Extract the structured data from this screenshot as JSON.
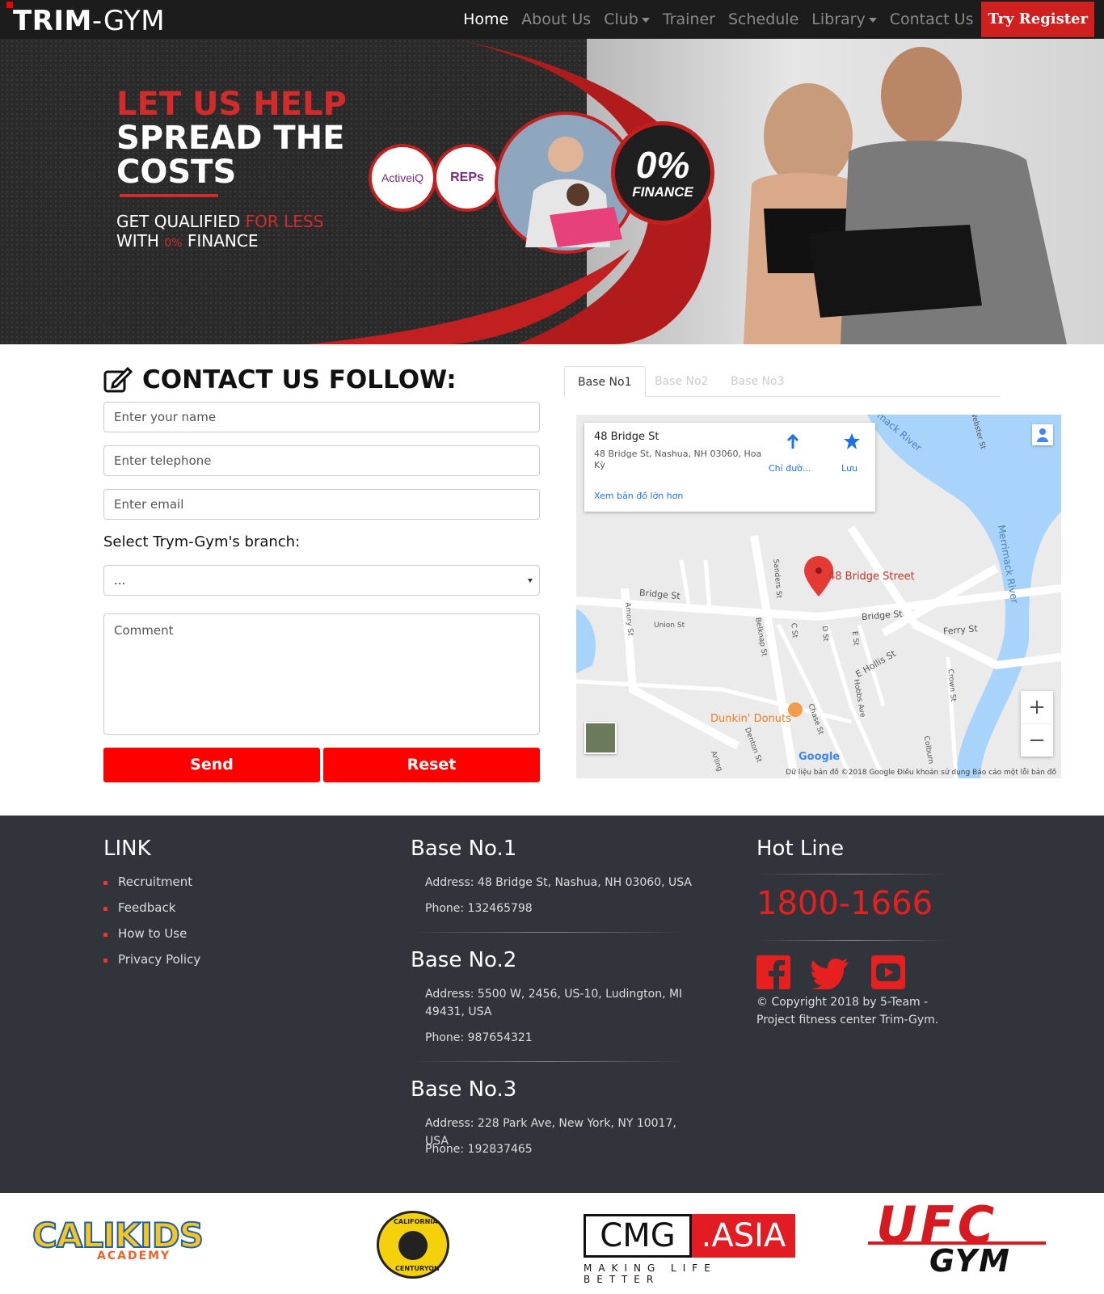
{
  "nav": {
    "logo_bold": "TRIM",
    "logo_light": "-GYM",
    "items": [
      {
        "label": "Home"
      },
      {
        "label": "About Us"
      },
      {
        "label": "Club"
      },
      {
        "label": "Trainer"
      },
      {
        "label": "Schedule"
      },
      {
        "label": "Library"
      },
      {
        "label": "Contact Us"
      }
    ],
    "cta": "Try Register"
  },
  "hero": {
    "line1": "LET US HELP",
    "line2": "SPREAD THE",
    "line3": "COSTS",
    "sub1_a": "GET QUALIFIED ",
    "sub1_b": "FOR LESS",
    "sub2_a": "WITH ",
    "sub2_b": "0%",
    "sub2_c": " FINANCE",
    "badge_activeiq": "ActiveiQ",
    "badge_reps": "REPs",
    "finance_big": "0%",
    "finance_word": "FINANCE"
  },
  "contact": {
    "title": "CONTACT US FOLLOW:",
    "name_placeholder": "Enter your name",
    "phone_placeholder": "Enter telephone",
    "email_placeholder": "Enter email",
    "branch_label": "Select Trym-Gym's branch:",
    "branch_selected": "...",
    "comment_placeholder": "Comment",
    "send": "Send",
    "reset": "Reset"
  },
  "tabs": [
    "Base No1",
    "Base No2",
    "Base No3"
  ],
  "map": {
    "place_title": "48 Bridge St",
    "place_address": "48 Bridge St, Nashua, NH 03060, Hoa Kỳ",
    "directions": "Chỉ đườ...",
    "save": "Lưu",
    "larger_map": "Xem bản đồ lớn hơn",
    "marker_label": "48 Bridge Street",
    "poi": "Dunkin' Donuts",
    "river1": "Merrimack River",
    "river2": "mack River",
    "streets": [
      "Bridge St",
      "Bridge St",
      "Ferry St",
      "E Hollis St",
      "Union St",
      "Amory St",
      "Sanders St",
      "Belknap St",
      "C St",
      "D St",
      "E St",
      "Hobbs Ave",
      "Chase St",
      "Denton St",
      "Crown St",
      "Colburn",
      "Webster St",
      "Arling"
    ],
    "google": "Google",
    "attribution": "Dữ liệu bản đồ ©2018 Google   Điều khoản sử dụng   Báo cáo một lỗi bản đồ",
    "zoom_in": "+",
    "zoom_out": "−"
  },
  "footer": {
    "link_title": "LINK",
    "links": [
      "Recruitment",
      "Feedback",
      "How to Use",
      "Privacy Policy"
    ],
    "bases": [
      {
        "title": "Base No.1",
        "address": "Address: 48 Bridge St, Nashua, NH 03060, USA",
        "phone": "Phone: 132465798"
      },
      {
        "title": "Base No.2",
        "address": "Address: 5500 W, 2456, US-10, Ludington, MI 49431, USA",
        "phone": "Phone: 987654321"
      },
      {
        "title": "Base No.3",
        "address": "Address: 228 Park Ave, New York, NY 10017, USA",
        "phone": "Phone: 192837465"
      }
    ],
    "hotline_title": "Hot Line",
    "hotline": "1800-1666",
    "social": [
      "facebook-icon",
      "twitter-icon",
      "youtube-icon"
    ],
    "copyright": "© Copyright 2018 by 5-Team - Project fitness center Trim-Gym."
  },
  "partners": {
    "calikids": "CALIKIDS",
    "calikids_sub": "ACADEMY",
    "california": "CALIFORNIA",
    "centuryon": "CENTURYON",
    "cmg": "CMG",
    "asia": ".ASIA",
    "cmg_sub": "MAKING LIFE BETTER",
    "ufc": "UFC",
    "gym": "GYM"
  },
  "colors": {
    "accent": "#ff0000",
    "nav_bg": "#1c1c1c",
    "footer_bg": "#31353b",
    "hero_red": "#d32b2b"
  }
}
